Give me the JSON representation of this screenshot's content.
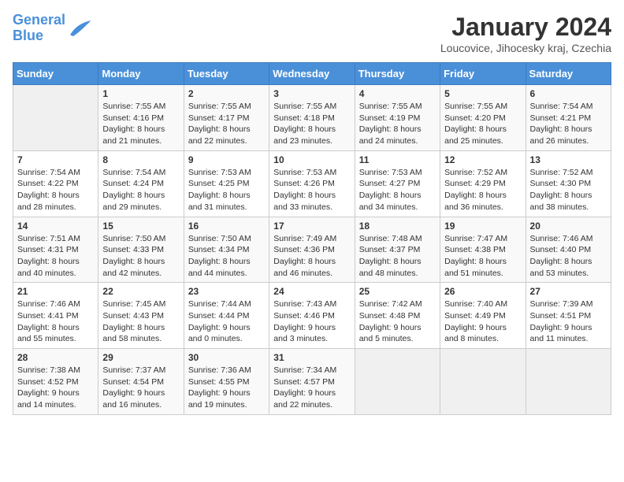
{
  "header": {
    "logo_line1": "General",
    "logo_line2": "Blue",
    "title": "January 2024",
    "subtitle": "Loucovice, Jihocesky kraj, Czechia"
  },
  "days_of_week": [
    "Sunday",
    "Monday",
    "Tuesday",
    "Wednesday",
    "Thursday",
    "Friday",
    "Saturday"
  ],
  "weeks": [
    [
      {
        "day": "",
        "info": ""
      },
      {
        "day": "1",
        "info": "Sunrise: 7:55 AM\nSunset: 4:16 PM\nDaylight: 8 hours\nand 21 minutes."
      },
      {
        "day": "2",
        "info": "Sunrise: 7:55 AM\nSunset: 4:17 PM\nDaylight: 8 hours\nand 22 minutes."
      },
      {
        "day": "3",
        "info": "Sunrise: 7:55 AM\nSunset: 4:18 PM\nDaylight: 8 hours\nand 23 minutes."
      },
      {
        "day": "4",
        "info": "Sunrise: 7:55 AM\nSunset: 4:19 PM\nDaylight: 8 hours\nand 24 minutes."
      },
      {
        "day": "5",
        "info": "Sunrise: 7:55 AM\nSunset: 4:20 PM\nDaylight: 8 hours\nand 25 minutes."
      },
      {
        "day": "6",
        "info": "Sunrise: 7:54 AM\nSunset: 4:21 PM\nDaylight: 8 hours\nand 26 minutes."
      }
    ],
    [
      {
        "day": "7",
        "info": "Sunrise: 7:54 AM\nSunset: 4:22 PM\nDaylight: 8 hours\nand 28 minutes."
      },
      {
        "day": "8",
        "info": "Sunrise: 7:54 AM\nSunset: 4:24 PM\nDaylight: 8 hours\nand 29 minutes."
      },
      {
        "day": "9",
        "info": "Sunrise: 7:53 AM\nSunset: 4:25 PM\nDaylight: 8 hours\nand 31 minutes."
      },
      {
        "day": "10",
        "info": "Sunrise: 7:53 AM\nSunset: 4:26 PM\nDaylight: 8 hours\nand 33 minutes."
      },
      {
        "day": "11",
        "info": "Sunrise: 7:53 AM\nSunset: 4:27 PM\nDaylight: 8 hours\nand 34 minutes."
      },
      {
        "day": "12",
        "info": "Sunrise: 7:52 AM\nSunset: 4:29 PM\nDaylight: 8 hours\nand 36 minutes."
      },
      {
        "day": "13",
        "info": "Sunrise: 7:52 AM\nSunset: 4:30 PM\nDaylight: 8 hours\nand 38 minutes."
      }
    ],
    [
      {
        "day": "14",
        "info": "Sunrise: 7:51 AM\nSunset: 4:31 PM\nDaylight: 8 hours\nand 40 minutes."
      },
      {
        "day": "15",
        "info": "Sunrise: 7:50 AM\nSunset: 4:33 PM\nDaylight: 8 hours\nand 42 minutes."
      },
      {
        "day": "16",
        "info": "Sunrise: 7:50 AM\nSunset: 4:34 PM\nDaylight: 8 hours\nand 44 minutes."
      },
      {
        "day": "17",
        "info": "Sunrise: 7:49 AM\nSunset: 4:36 PM\nDaylight: 8 hours\nand 46 minutes."
      },
      {
        "day": "18",
        "info": "Sunrise: 7:48 AM\nSunset: 4:37 PM\nDaylight: 8 hours\nand 48 minutes."
      },
      {
        "day": "19",
        "info": "Sunrise: 7:47 AM\nSunset: 4:38 PM\nDaylight: 8 hours\nand 51 minutes."
      },
      {
        "day": "20",
        "info": "Sunrise: 7:46 AM\nSunset: 4:40 PM\nDaylight: 8 hours\nand 53 minutes."
      }
    ],
    [
      {
        "day": "21",
        "info": "Sunrise: 7:46 AM\nSunset: 4:41 PM\nDaylight: 8 hours\nand 55 minutes."
      },
      {
        "day": "22",
        "info": "Sunrise: 7:45 AM\nSunset: 4:43 PM\nDaylight: 8 hours\nand 58 minutes."
      },
      {
        "day": "23",
        "info": "Sunrise: 7:44 AM\nSunset: 4:44 PM\nDaylight: 9 hours\nand 0 minutes."
      },
      {
        "day": "24",
        "info": "Sunrise: 7:43 AM\nSunset: 4:46 PM\nDaylight: 9 hours\nand 3 minutes."
      },
      {
        "day": "25",
        "info": "Sunrise: 7:42 AM\nSunset: 4:48 PM\nDaylight: 9 hours\nand 5 minutes."
      },
      {
        "day": "26",
        "info": "Sunrise: 7:40 AM\nSunset: 4:49 PM\nDaylight: 9 hours\nand 8 minutes."
      },
      {
        "day": "27",
        "info": "Sunrise: 7:39 AM\nSunset: 4:51 PM\nDaylight: 9 hours\nand 11 minutes."
      }
    ],
    [
      {
        "day": "28",
        "info": "Sunrise: 7:38 AM\nSunset: 4:52 PM\nDaylight: 9 hours\nand 14 minutes."
      },
      {
        "day": "29",
        "info": "Sunrise: 7:37 AM\nSunset: 4:54 PM\nDaylight: 9 hours\nand 16 minutes."
      },
      {
        "day": "30",
        "info": "Sunrise: 7:36 AM\nSunset: 4:55 PM\nDaylight: 9 hours\nand 19 minutes."
      },
      {
        "day": "31",
        "info": "Sunrise: 7:34 AM\nSunset: 4:57 PM\nDaylight: 9 hours\nand 22 minutes."
      },
      {
        "day": "",
        "info": ""
      },
      {
        "day": "",
        "info": ""
      },
      {
        "day": "",
        "info": ""
      }
    ]
  ]
}
